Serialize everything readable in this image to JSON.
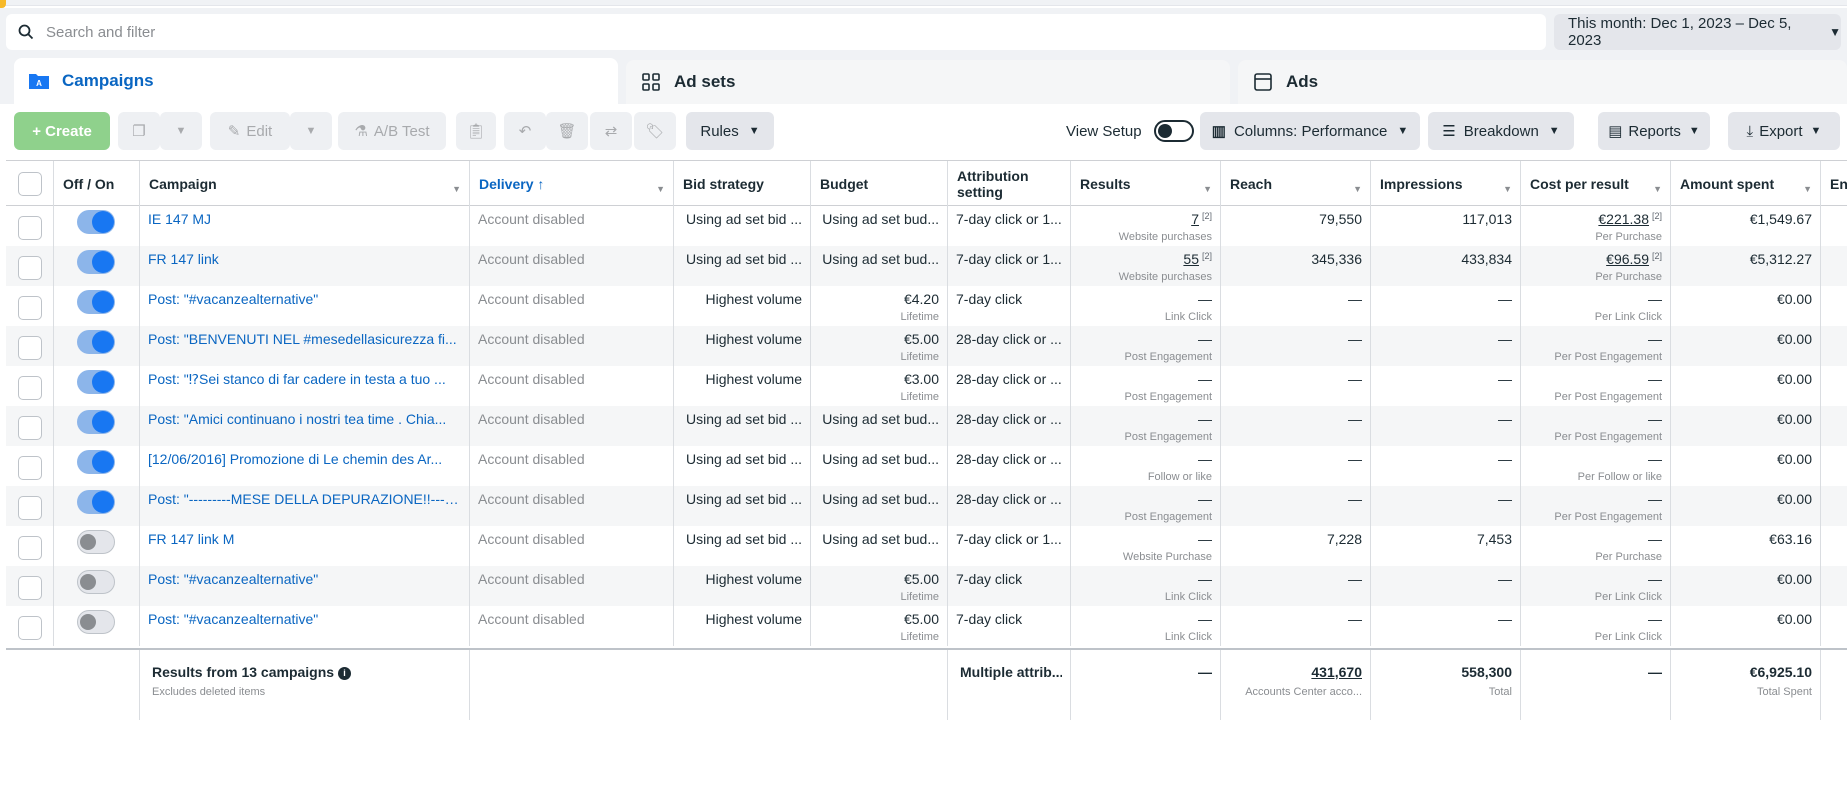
{
  "search": {
    "placeholder": "Search and filter"
  },
  "date_range": {
    "label": "This month: Dec 1, 2023 – Dec 5, 2023"
  },
  "tabs": [
    {
      "label": "Campaigns",
      "icon": "folder-icon",
      "active": true
    },
    {
      "label": "Ad sets",
      "icon": "grid-icon",
      "active": false
    },
    {
      "label": "Ads",
      "icon": "ad-frame-icon",
      "active": false
    }
  ],
  "toolbar": {
    "create_label": "+ Create",
    "edit_label": "Edit",
    "ab_test_label": "A/B Test",
    "rules_label": "Rules",
    "view_setup_label": "View Setup",
    "columns_label": "Columns: Performance",
    "breakdown_label": "Breakdown",
    "reports_label": "Reports",
    "export_label": "Export"
  },
  "columns": [
    "Off / On",
    "Campaign",
    "Delivery ↑",
    "Bid strategy",
    "Budget",
    "Attribution setting",
    "Results",
    "Reach",
    "Impressions",
    "Cost per result",
    "Amount spent",
    "En"
  ],
  "rows": [
    {
      "on": true,
      "campaign": "IE 147 MJ",
      "delivery": "Account disabled",
      "bid": "Using ad set bid ...",
      "budget": "Using ad set bud...",
      "budget_sub": "",
      "attribution": "7-day click or 1...",
      "results": "7",
      "results_sup": "[2]",
      "results_sub": "Website purchases",
      "reach": "79,550",
      "impressions": "117,013",
      "cpr": "€221.38",
      "cpr_sup": "[2]",
      "cpr_sub": "Per Purchase",
      "spent": "€1,549.67"
    },
    {
      "on": true,
      "campaign": "FR 147 link",
      "delivery": "Account disabled",
      "bid": "Using ad set bid ...",
      "budget": "Using ad set bud...",
      "budget_sub": "",
      "attribution": "7-day click or 1...",
      "results": "55",
      "results_sup": "[2]",
      "results_sub": "Website purchases",
      "reach": "345,336",
      "impressions": "433,834",
      "cpr": "€96.59",
      "cpr_sup": "[2]",
      "cpr_sub": "Per Purchase",
      "spent": "€5,312.27"
    },
    {
      "on": true,
      "campaign": "Post: \"#vacanzealternative\"",
      "delivery": "Account disabled",
      "bid": "Highest volume",
      "budget": "€4.20",
      "budget_sub": "Lifetime",
      "attribution": "7-day click",
      "results": "—",
      "results_sup": "",
      "results_sub": "Link Click",
      "reach": "—",
      "impressions": "—",
      "cpr": "—",
      "cpr_sup": "",
      "cpr_sub": "Per Link Click",
      "spent": "€0.00"
    },
    {
      "on": true,
      "campaign": "Post: \"BENVENUTI NEL #mesedellasicurezza fi...",
      "delivery": "Account disabled",
      "bid": "Highest volume",
      "budget": "€5.00",
      "budget_sub": "Lifetime",
      "attribution": "28-day click or ...",
      "results": "—",
      "results_sup": "",
      "results_sub": "Post Engagement",
      "reach": "—",
      "impressions": "—",
      "cpr": "—",
      "cpr_sup": "",
      "cpr_sub": "Per Post Engagement",
      "spent": "€0.00"
    },
    {
      "on": true,
      "campaign": "Post: \"⁉Sei stanco di far cadere in testa a tuo ...",
      "delivery": "Account disabled",
      "bid": "Highest volume",
      "budget": "€3.00",
      "budget_sub": "Lifetime",
      "attribution": "28-day click or ...",
      "results": "—",
      "results_sup": "",
      "results_sub": "Post Engagement",
      "reach": "—",
      "impressions": "—",
      "cpr": "—",
      "cpr_sup": "",
      "cpr_sub": "Per Post Engagement",
      "spent": "€0.00"
    },
    {
      "on": true,
      "campaign": "Post: \"Amici continuano i nostri tea time . Chia...",
      "delivery": "Account disabled",
      "bid": "Using ad set bid ...",
      "budget": "Using ad set bud...",
      "budget_sub": "",
      "attribution": "28-day click or ...",
      "results": "—",
      "results_sup": "",
      "results_sub": "Post Engagement",
      "reach": "—",
      "impressions": "—",
      "cpr": "—",
      "cpr_sup": "",
      "cpr_sub": "Per Post Engagement",
      "spent": "€0.00"
    },
    {
      "on": true,
      "campaign": "[12/06/2016] Promozione di Le chemin des Ar...",
      "delivery": "Account disabled",
      "bid": "Using ad set bid ...",
      "budget": "Using ad set bud...",
      "budget_sub": "",
      "attribution": "28-day click or ...",
      "results": "—",
      "results_sup": "",
      "results_sub": "Follow or like",
      "reach": "—",
      "impressions": "—",
      "cpr": "—",
      "cpr_sup": "",
      "cpr_sub": "Per Follow or like",
      "spent": "€0.00"
    },
    {
      "on": true,
      "campaign": "Post: \"---------MESE DELLA DEPURAZIONE!!---------...",
      "delivery": "Account disabled",
      "bid": "Using ad set bid ...",
      "budget": "Using ad set bud...",
      "budget_sub": "",
      "attribution": "28-day click or ...",
      "results": "—",
      "results_sup": "",
      "results_sub": "Post Engagement",
      "reach": "—",
      "impressions": "—",
      "cpr": "—",
      "cpr_sup": "",
      "cpr_sub": "Per Post Engagement",
      "spent": "€0.00"
    },
    {
      "on": false,
      "campaign": "FR 147 link M",
      "delivery": "Account disabled",
      "bid": "Using ad set bid ...",
      "budget": "Using ad set bud...",
      "budget_sub": "",
      "attribution": "7-day click or 1...",
      "results": "—",
      "results_sup": "",
      "results_sub": "Website Purchase",
      "reach": "7,228",
      "impressions": "7,453",
      "cpr": "—",
      "cpr_sup": "",
      "cpr_sub": "Per Purchase",
      "spent": "€63.16"
    },
    {
      "on": false,
      "campaign": "Post: \"#vacanzealternative\"",
      "delivery": "Account disabled",
      "bid": "Highest volume",
      "budget": "€5.00",
      "budget_sub": "Lifetime",
      "attribution": "7-day click",
      "results": "—",
      "results_sup": "",
      "results_sub": "Link Click",
      "reach": "—",
      "impressions": "—",
      "cpr": "—",
      "cpr_sup": "",
      "cpr_sub": "Per Link Click",
      "spent": "€0.00"
    },
    {
      "on": false,
      "campaign": "Post: \"#vacanzealternative\"",
      "delivery": "Account disabled",
      "bid": "Highest volume",
      "budget": "€5.00",
      "budget_sub": "Lifetime",
      "attribution": "7-day click",
      "results": "—",
      "results_sup": "",
      "results_sub": "Link Click",
      "reach": "—",
      "impressions": "—",
      "cpr": "—",
      "cpr_sup": "",
      "cpr_sub": "Per Link Click",
      "spent": "€0.00"
    }
  ],
  "footer": {
    "title": "Results from 13 campaigns",
    "subtitle": "Excludes deleted items",
    "attribution": "Multiple attrib...",
    "results": "—",
    "reach": "431,670",
    "reach_sub": "Accounts Center acco...",
    "impressions": "558,300",
    "impressions_sub": "Total",
    "cpr": "—",
    "spent": "€6,925.10",
    "spent_sub": "Total Spent"
  }
}
